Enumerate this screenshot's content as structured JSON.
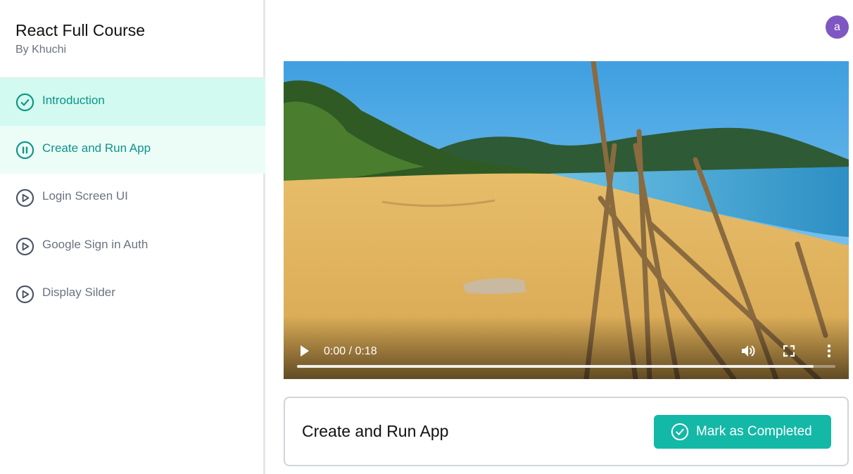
{
  "course": {
    "title": "React Full Course",
    "author": "By Khuchi"
  },
  "lessons": [
    {
      "label": "Introduction",
      "status": "completed",
      "icon": "check-circle-icon"
    },
    {
      "label": "Create and Run App",
      "status": "playing",
      "icon": "pause-circle-icon"
    },
    {
      "label": "Login Screen UI",
      "status": "pending",
      "icon": "play-circle-icon"
    },
    {
      "label": "Google Sign in Auth",
      "status": "pending",
      "icon": "play-circle-icon"
    },
    {
      "label": "Display Silder",
      "status": "pending",
      "icon": "play-circle-icon"
    }
  ],
  "user": {
    "avatar_letter": "a",
    "avatar_color": "#7e57c2"
  },
  "video": {
    "time_display": "0:00 / 0:18",
    "buffered_fraction": 0.96,
    "played_fraction": 0.0
  },
  "current_lesson": {
    "title": "Create and Run App"
  },
  "actions": {
    "mark_completed_label": "Mark as Completed"
  },
  "colors": {
    "accent": "#14b8a6",
    "accent_text": "#0d9488",
    "completed_bg": "#d2faf0",
    "active_bg": "#ecfdf8"
  }
}
